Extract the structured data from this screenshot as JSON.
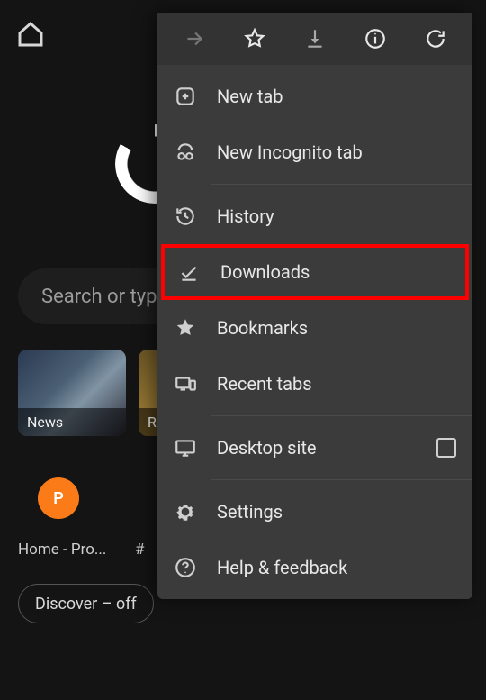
{
  "background": {
    "search_placeholder": "Search or typ",
    "tiles": [
      {
        "label": "News"
      },
      {
        "label": "Re"
      }
    ],
    "favorite": {
      "initial": "P",
      "label": "Home - Pro...",
      "hash": "#"
    },
    "discover_label": "Discover – off"
  },
  "menu": {
    "top": {
      "forward": "forward-icon",
      "star": "star-icon",
      "download": "download-icon",
      "info": "info-icon",
      "reload": "reload-icon"
    },
    "items": {
      "new_tab": "New tab",
      "incognito": "New Incognito tab",
      "history": "History",
      "downloads": "Downloads",
      "bookmarks": "Bookmarks",
      "recent_tabs": "Recent tabs",
      "desktop_site": "Desktop site",
      "settings": "Settings",
      "help": "Help & feedback"
    }
  }
}
